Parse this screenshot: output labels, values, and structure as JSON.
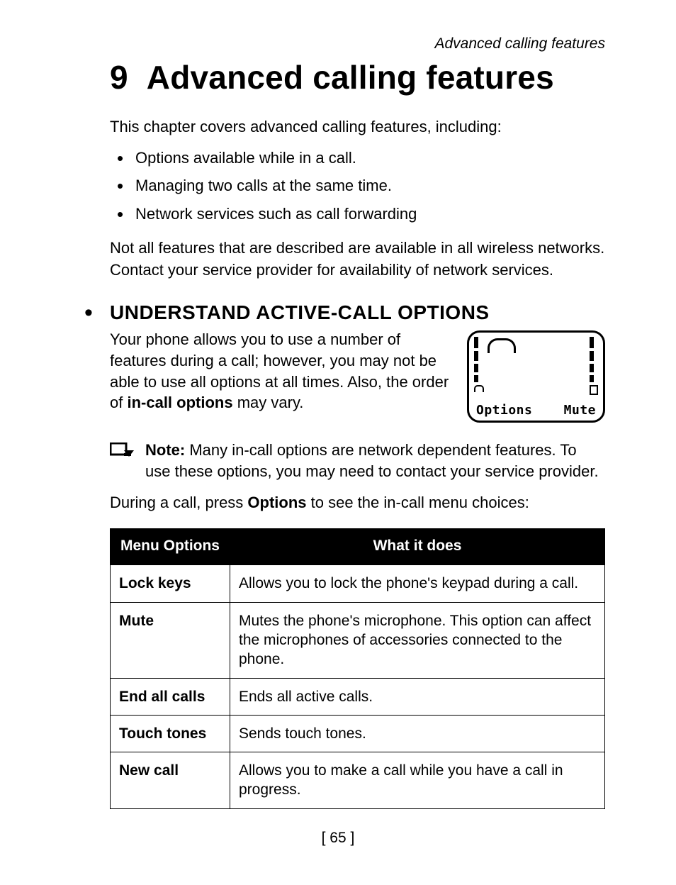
{
  "running_head": "Advanced calling features",
  "chapter": {
    "number": "9",
    "title": "Advanced calling features"
  },
  "intro": "This chapter covers advanced calling features, including:",
  "bullets": [
    "Options available while in a call.",
    "Managing two calls at the same time.",
    "Network services such as call forwarding"
  ],
  "after_bullets": "Not all features that are described are available in all wireless networks. Contact your service provider for availability of network services.",
  "section1": {
    "title": "UNDERSTAND ACTIVE-CALL OPTIONS",
    "para_pre": "Your phone allows you to use a number of features during a call; however, you may not be able to use all options at all times. Also, the order of ",
    "para_bold": "in-call options",
    "para_post": " may vary."
  },
  "phone": {
    "soft_left": "Options",
    "soft_right": "Mute"
  },
  "note": {
    "label": "Note:",
    "text": " Many in-call options are network dependent features. To use these options, you may need to contact your service provider."
  },
  "press_line": {
    "pre": "During a call, press ",
    "bold": "Options",
    "post": " to see the in-call menu choices:"
  },
  "table": {
    "head_option": "Menu Options",
    "head_desc": "What it does",
    "rows": [
      {
        "opt": "Lock keys",
        "desc": "Allows you to lock the phone's keypad during a call."
      },
      {
        "opt": "Mute",
        "desc": "Mutes the phone's microphone. This option can affect the microphones of accessories connected to the phone."
      },
      {
        "opt": "End all calls",
        "desc": "Ends all active calls."
      },
      {
        "opt": "Touch tones",
        "desc": "Sends touch tones."
      },
      {
        "opt": "New call",
        "desc": "Allows you to make a call while you have a call in progress."
      }
    ]
  },
  "page_number": "[ 65 ]"
}
